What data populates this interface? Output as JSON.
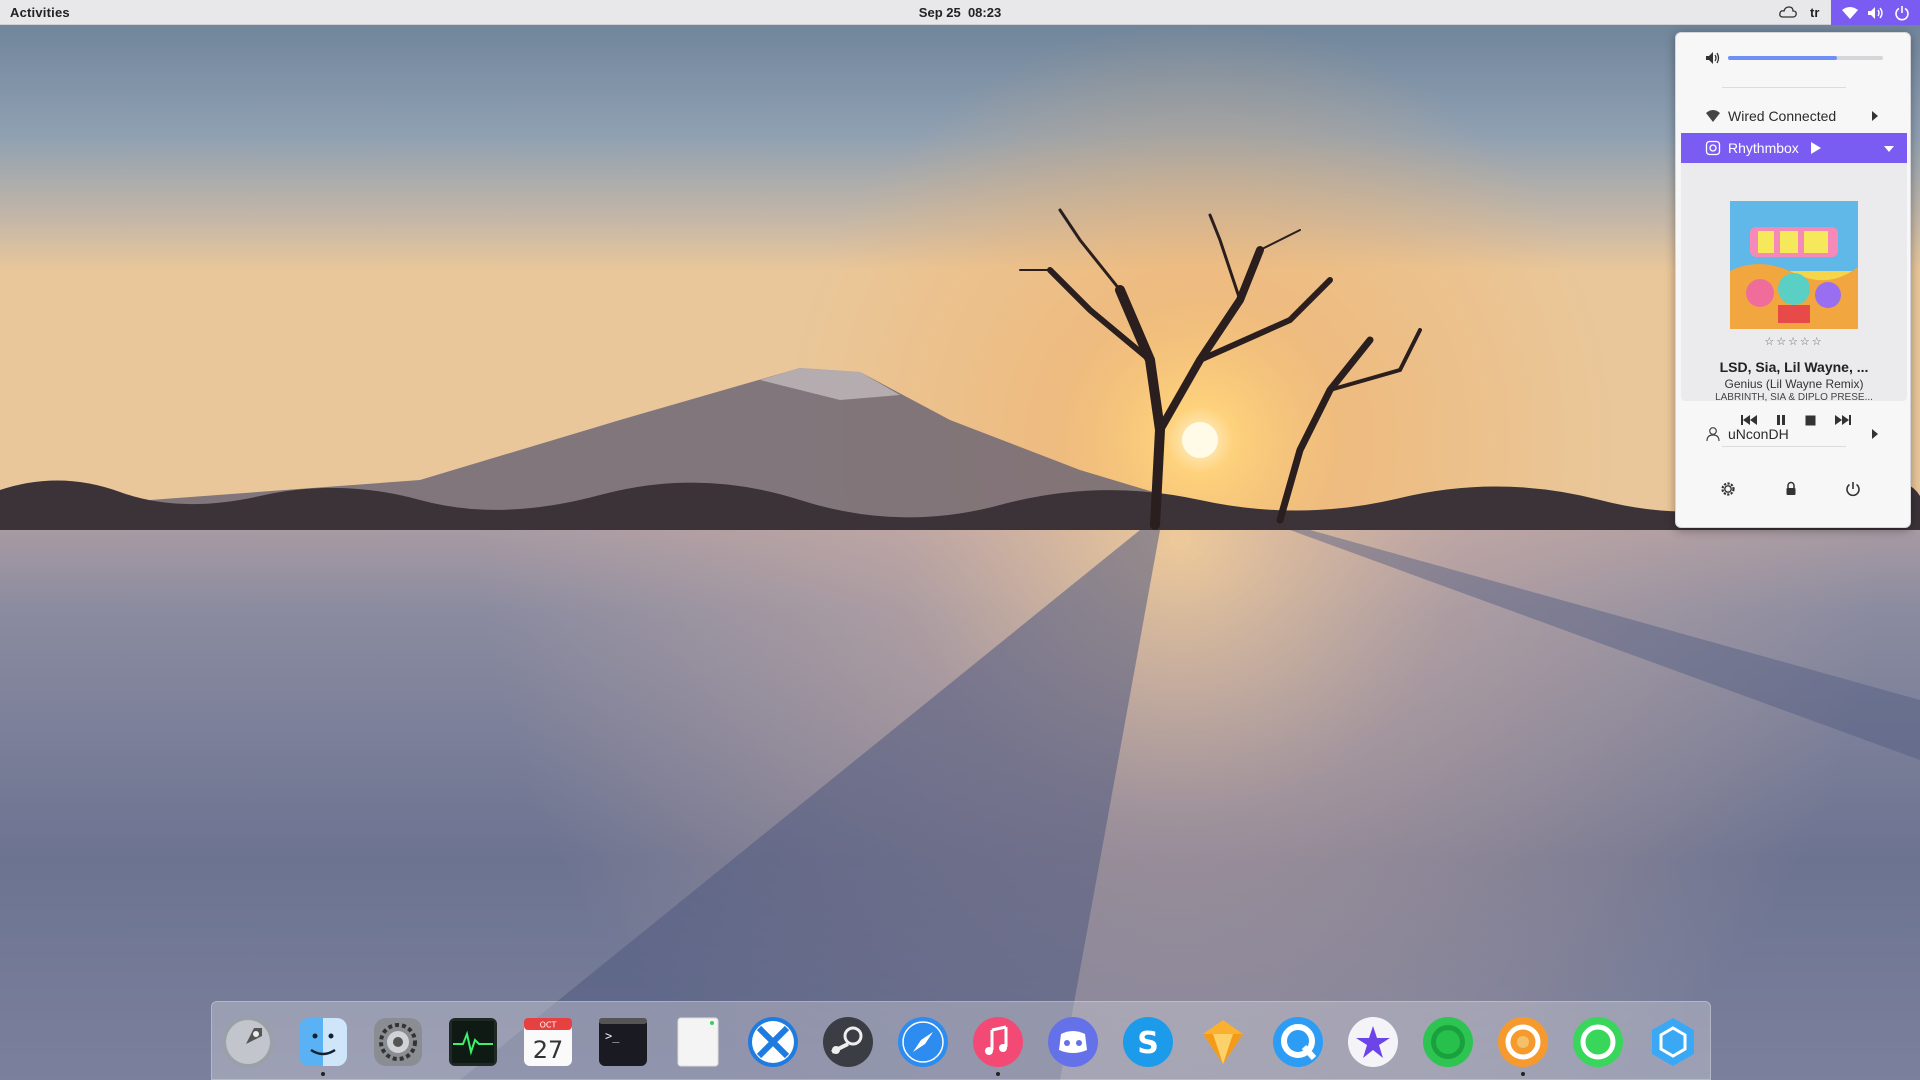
{
  "topbar": {
    "activities_label": "Activities",
    "clock_date": "Sep 25",
    "clock_time": "08:23",
    "keyboard_layout": "tr"
  },
  "system_menu": {
    "volume_level": 0.7,
    "network_label": "Wired Connected",
    "player": {
      "app_name": "Rhythmbox",
      "rating_stars": "☆☆☆☆☆",
      "artist": "LSD, Sia, Lil Wayne, ...",
      "title": "Genius (Lil Wayne Remix)",
      "album": "LABRINTH, SIA & DIPLO PRESE..."
    },
    "user_label": "uNconDH"
  },
  "dock": {
    "items": [
      {
        "name": "launchpad-icon",
        "running": false
      },
      {
        "name": "finder-icon",
        "running": true
      },
      {
        "name": "system-preferences-icon",
        "running": false
      },
      {
        "name": "activity-monitor-icon",
        "running": false
      },
      {
        "name": "calendar-icon",
        "running": false,
        "month": "OCT",
        "day": "27"
      },
      {
        "name": "terminal-icon",
        "running": false
      },
      {
        "name": "text-editor-icon",
        "running": false
      },
      {
        "name": "x-app-icon",
        "running": false
      },
      {
        "name": "steam-icon",
        "running": false
      },
      {
        "name": "safari-icon",
        "running": false
      },
      {
        "name": "music-icon",
        "running": true
      },
      {
        "name": "discord-icon",
        "running": false
      },
      {
        "name": "skype-icon",
        "running": false
      },
      {
        "name": "sketch-icon",
        "running": false
      },
      {
        "name": "quicktime-icon",
        "running": false
      },
      {
        "name": "star-app-icon",
        "running": false
      },
      {
        "name": "green-chat-icon",
        "running": false
      },
      {
        "name": "orange-ring-icon",
        "running": true
      },
      {
        "name": "green-ring-icon",
        "running": false
      },
      {
        "name": "hexagon-app-icon",
        "running": false
      }
    ]
  },
  "colors": {
    "accent": "#7b5cf2",
    "slider_fill": "#6e8ff5"
  }
}
